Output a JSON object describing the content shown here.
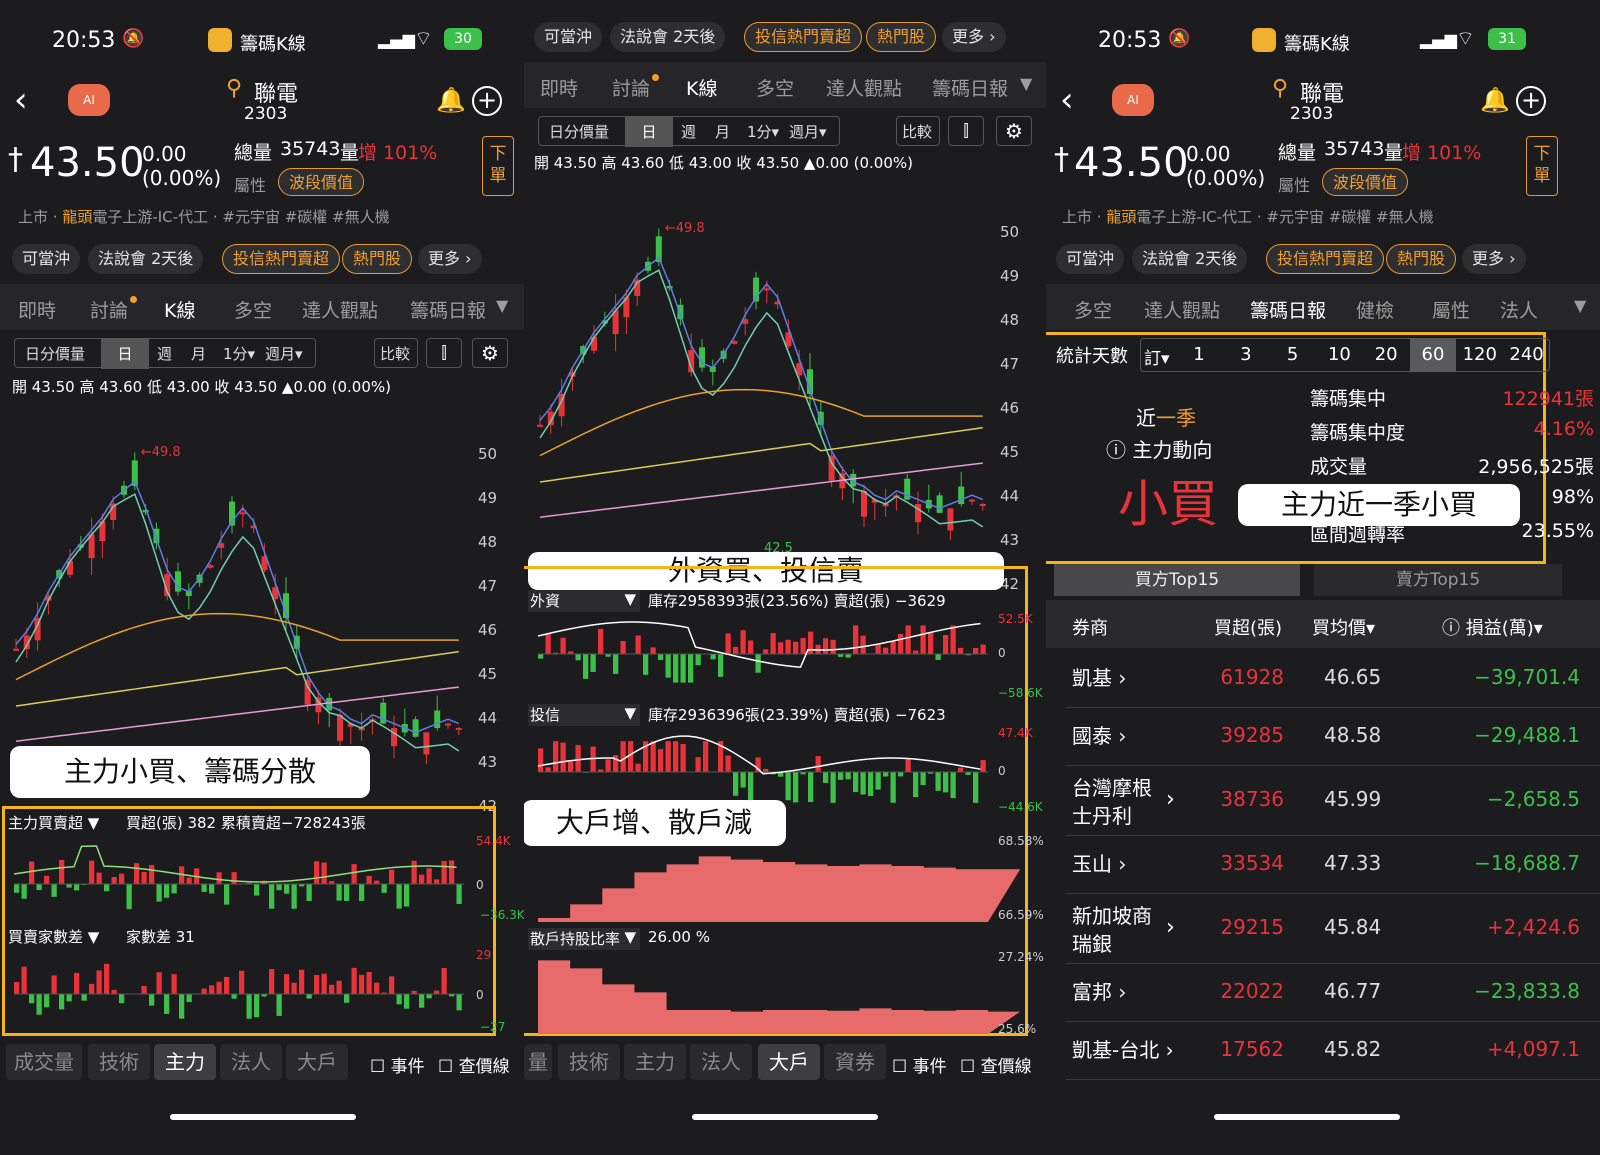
{
  "status": {
    "time": "20:53",
    "app_left": "籌碼K線",
    "battery_left": "30",
    "battery_right": "31"
  },
  "stock": {
    "name": "聯電",
    "code": "2303",
    "price": "43.50",
    "change": "0.00",
    "pct": "(0.00%)",
    "total_label": "總量",
    "total_value": "35743",
    "vol_label": "量",
    "vol_change": "增 101%",
    "attr_label": "屬性",
    "wave_label": "波段價值",
    "tags_market": "上市 ·",
    "tags_lead": "龍頭",
    "tags_rest": "電子上游-IC-代工 · #元宇宙 #碳權 #無人機",
    "order": "下單"
  },
  "pills": {
    "daytrade": "可當沖",
    "conf": "法說會 2天後",
    "trust": "投信熱門賣超",
    "hot": "熱門股",
    "more": "更多 ›"
  },
  "tabs": [
    "即時",
    "討論",
    "K線",
    "多空",
    "達人觀點",
    "籌碼日報"
  ],
  "tabs_right": [
    "多空",
    "達人觀點",
    "籌碼日報",
    "健檢",
    "屬性",
    "法人"
  ],
  "toolbar": {
    "minute": "日分價量",
    "day": "日",
    "week": "週",
    "month": "月",
    "m1": "1分▾",
    "weekmonth": "週月▾",
    "compare": "比較"
  },
  "ohlc": "開 43.50  高 43.60  低 43.00  收 43.50  ▲0.00 (0.00%)",
  "price_axis": [
    "50",
    "49",
    "48",
    "47",
    "46",
    "45",
    "44",
    "43",
    "42"
  ],
  "peak_label": "←49.8",
  "low_label": "42.5",
  "panel1": {
    "main_ind": "主力買賣超",
    "main_val": "買超(張) 382  累積賣超−728243張",
    "main_axis": [
      "54.4K",
      "0",
      "−36.3K"
    ],
    "diff_ind": "買賣家數差",
    "diff_val": "家數差 31",
    "diff_axis": [
      "29",
      "0",
      "−27"
    ],
    "bottom": [
      "成交量",
      "技術",
      "主力",
      "法人",
      "大戶"
    ],
    "event": "事件",
    "price_line": "查價線",
    "callout": "主力小買、籌碼分散"
  },
  "panel2": {
    "foreign_ind": "外資",
    "foreign_val": "庫存2958393張(23.56%)  賣超(張) −3629",
    "foreign_axis": [
      "52.5K",
      "0",
      "−58.6K"
    ],
    "trust_ind": "投信",
    "trust_val": "庫存2936396張(23.39%)  賣超(張) −7623",
    "trust_axis": [
      "47.4K",
      "0",
      "−44.6K"
    ],
    "big_axis": [
      "68.58%",
      "66.59%"
    ],
    "retail_ind": "散戶持股比率",
    "retail_val": "26.00 %",
    "retail_axis": [
      "27.24%",
      "25.6%"
    ],
    "bottom": [
      "量",
      "技術",
      "主力",
      "法人",
      "大戶",
      "資券"
    ],
    "callout1": "外資買、投信賣",
    "callout2": "大戶增、散戶減"
  },
  "panel3": {
    "days_label": "統計天數",
    "custom": "訂▾",
    "days": [
      "1",
      "3",
      "5",
      "10",
      "20",
      "60",
      "120",
      "240"
    ],
    "period_a": "近",
    "period_b": "一季",
    "flow_label": "ⓘ 主力動向",
    "flow_value": "小買",
    "stats": [
      {
        "k": "籌碼集中",
        "v": "122941張"
      },
      {
        "k": "籌碼集中度",
        "v": "4.16%"
      },
      {
        "k": "成交量",
        "v": "2,956,525張"
      },
      {
        "k": "",
        "v": "98%"
      },
      {
        "k": "區間週轉率",
        "v": "23.55%"
      }
    ],
    "callout": "主力近一季小買",
    "buy_tab": "買方Top15",
    "sell_tab": "賣方Top15",
    "cols": [
      "券商",
      "買超(張)",
      "買均價▾",
      "ⓘ 損益(萬)▾"
    ],
    "rows": [
      {
        "broker": "凱基 ›",
        "net": "61928",
        "avg": "46.65",
        "pl": "−39,701.4"
      },
      {
        "broker": "國泰 ›",
        "net": "39285",
        "avg": "48.58",
        "pl": "−29,488.1"
      },
      {
        "broker": "台灣摩根\n士丹利",
        "net": "38736",
        "avg": "45.99",
        "pl": "−2,658.5"
      },
      {
        "broker": "玉山 ›",
        "net": "33534",
        "avg": "47.33",
        "pl": "−18,688.7"
      },
      {
        "broker": "新加坡商\n瑞銀",
        "net": "29215",
        "avg": "45.84",
        "pl": "+2,424.6"
      },
      {
        "broker": "富邦 ›",
        "net": "22022",
        "avg": "46.77",
        "pl": "−23,833.8"
      },
      {
        "broker": "凱基-台北 ›",
        "net": "17562",
        "avg": "45.82",
        "pl": "+4,097.1"
      }
    ]
  },
  "colors": {
    "bg": "#1c1c1e",
    "up": "#e8333b",
    "down": "#3cc04a",
    "accent": "#f5b51a",
    "ma5": "#5b7ee5",
    "ma10": "#6fd0b0",
    "ma20": "#e8a030",
    "ma60": "#d8cf5a",
    "ma120": "#e89ad8"
  }
}
